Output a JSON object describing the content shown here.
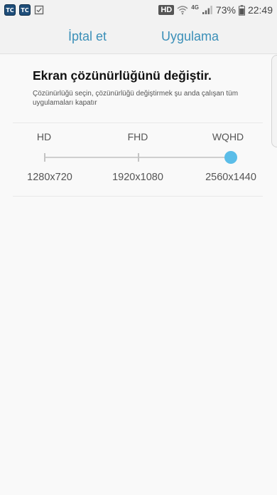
{
  "status_bar": {
    "app_icon_1": "TC",
    "app_icon_2": "TC",
    "hd_badge": "HD",
    "network_type": "4G",
    "battery_percent": "73%",
    "time": "22:49"
  },
  "header": {
    "cancel_label": "İptal et",
    "apply_label": "Uygulama"
  },
  "main": {
    "title": "Ekran çözünürlüğünü değiştir.",
    "description": "Çözünürlüğü seçin, çözünürlüğü değiştirmek şu anda çalışan tüm uygulamaları kapatır"
  },
  "resolution_slider": {
    "options": [
      {
        "level": "HD",
        "resolution": "1280x720"
      },
      {
        "level": "FHD",
        "resolution": "1920x1080"
      },
      {
        "level": "WQHD",
        "resolution": "2560x1440"
      }
    ],
    "selected_index": 2,
    "accent_color": "#5bbde8"
  },
  "colors": {
    "accent_text": "#3a8fb8"
  }
}
